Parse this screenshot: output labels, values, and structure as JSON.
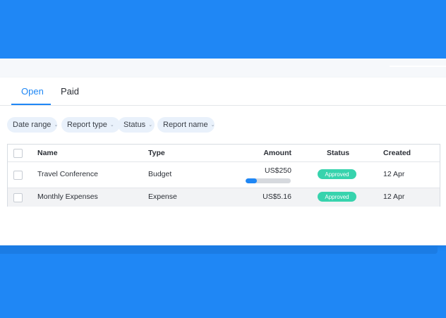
{
  "tabs": [
    {
      "label": "Open",
      "active": true
    },
    {
      "label": "Paid",
      "active": false
    }
  ],
  "filters": [
    "Date range",
    "Report type",
    "Status",
    "Report name"
  ],
  "table": {
    "headers": {
      "name": "Name",
      "type": "Type",
      "amount": "Amount",
      "status": "Status",
      "created": "Created"
    },
    "rows": [
      {
        "name": "Travel Conference",
        "type": "Budget",
        "amount": "US$250",
        "status": "Approved",
        "created": "12 Apr",
        "budget_progress_percent": 25
      },
      {
        "name": "Monthly Expenses",
        "type": "Expense",
        "amount": "US$5.16",
        "status": "Approved",
        "created": "12 Apr"
      }
    ]
  },
  "colors": {
    "accent": "#1f87f5",
    "approved": "#37d3ad",
    "background": "#1f87f5"
  },
  "icons": {
    "chip_chevron": "chevron-down-icon"
  }
}
